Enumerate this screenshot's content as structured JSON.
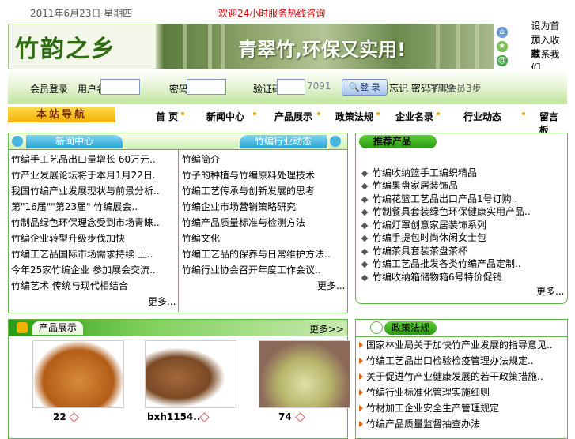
{
  "topbar": {
    "date": "2011年6月23日 星期四",
    "notice": "欢迎24小时服务热线咨询"
  },
  "header": {
    "logo_text": "竹韵之乡",
    "slogan": "青翠竹,环保又实用!"
  },
  "quick_links": [
    {
      "label": "设为首页",
      "icon": "home-icon"
    },
    {
      "label": "加入收藏",
      "icon": "star-icon"
    },
    {
      "label": "联系我们",
      "icon": "mail-icon"
    }
  ],
  "login": {
    "user_label": "会员登录",
    "username_label": "用户名：",
    "password_label": "密码：",
    "code_label": "验证码：",
    "code_value": "7091",
    "login_button": "登 录",
    "forgot": "忘记 密码了吗?",
    "register": "注册会员3步"
  },
  "nav": {
    "label": "本站导航",
    "items": [
      "首 页",
      "新闻中心",
      "产品展示",
      "政策法规",
      "企业名录",
      "行业动态",
      "留言板"
    ]
  },
  "news": {
    "tab_left": "新闻中心",
    "tab_right": "竹编行业动态",
    "left_items": [
      "竹编手工艺品出口量增长 60万元..",
      "竹产业发展论坛将于本月1月22日..",
      "我国竹编产业发展现状与前景分析..",
      "第\"16届\"\"第23届\" 竹编展会..",
      "竹制品绿色环保理念受到市场青睐..",
      "竹编企业转型升级步伐加快",
      "竹编工艺品国际市场需求持续 上..",
      "今年25家竹编企业 参加展会交流.."
    ],
    "left_extra": "竹编艺术 传统与现代相结合",
    "left_more": "更多...",
    "right_items": [
      "竹编简介",
      "竹子的种植与竹编原料处理技术",
      "竹编工艺传承与创新发展的思考",
      "竹编企业市场营销策略研究",
      "竹编产品质量标准与检测方法",
      "竹编文化",
      "竹编工艺品的保养与日常维护方法..",
      "竹编行业协会召开年度工作会议.."
    ],
    "right_more": "更多..."
  },
  "recommend": {
    "tab": "推荐产品",
    "items": [
      "竹编收纳篮手工编织精品",
      "竹编果盘家居装饰品",
      "竹编花篮工艺品出口产品1号订购..",
      "竹制餐具套装绿色环保健康实用产品..",
      "竹编灯罩创意家居装饰系列",
      "竹编手提包时尚休闲女士包",
      "竹编茶具套装茶盘茶杯",
      "竹编工艺品批发各类竹编产品定制..",
      "竹编收纳箱储物箱6号特价促销"
    ],
    "more": "更多..."
  },
  "products": {
    "tab": "产品展示",
    "more": "更多>>",
    "items": [
      {
        "name": "22"
      },
      {
        "name": "bxh1154.."
      },
      {
        "name": "74"
      }
    ]
  },
  "policy": {
    "tab": "政策法规",
    "items": [
      "国家林业局关于加快竹产业发展的指导意见..",
      "竹编工艺品出口检验检疫管理办法规定..",
      "关于促进竹产业健康发展的若干政策措施..",
      "竹编行业标准化管理实施细则",
      "竹材加工企业安全生产管理规定",
      "竹编产品质量监督抽查办法"
    ]
  },
  "colors": {
    "accent_green": "#2a9a14",
    "notice_red": "#e00000",
    "nav_yellow": "#f2b200"
  }
}
